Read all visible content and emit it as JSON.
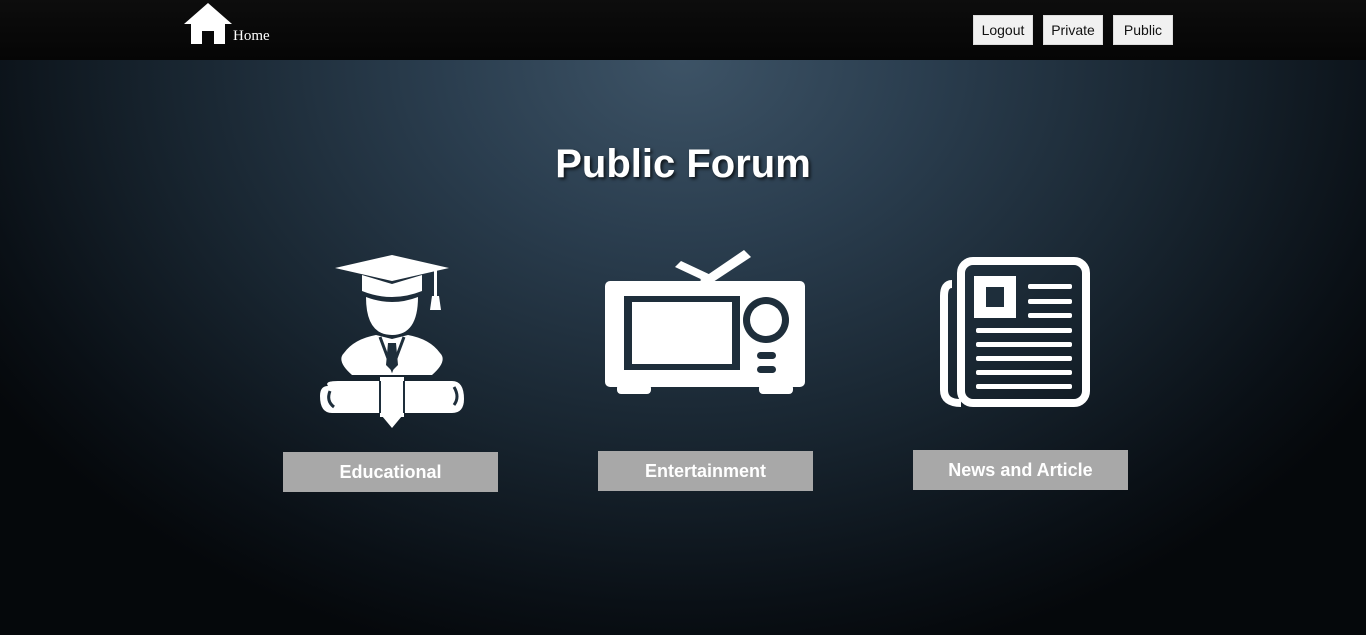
{
  "header": {
    "home_label": "Home",
    "icon": "house-icon",
    "nav": {
      "logout": "Logout",
      "private": "Private",
      "public": "Public"
    }
  },
  "main": {
    "title": "Public Forum",
    "categories": [
      {
        "label": "Educational",
        "icon": "graduate-icon"
      },
      {
        "label": "Entertainment",
        "icon": "television-icon"
      },
      {
        "label": "News and Article",
        "icon": "newspaper-icon"
      }
    ]
  }
}
